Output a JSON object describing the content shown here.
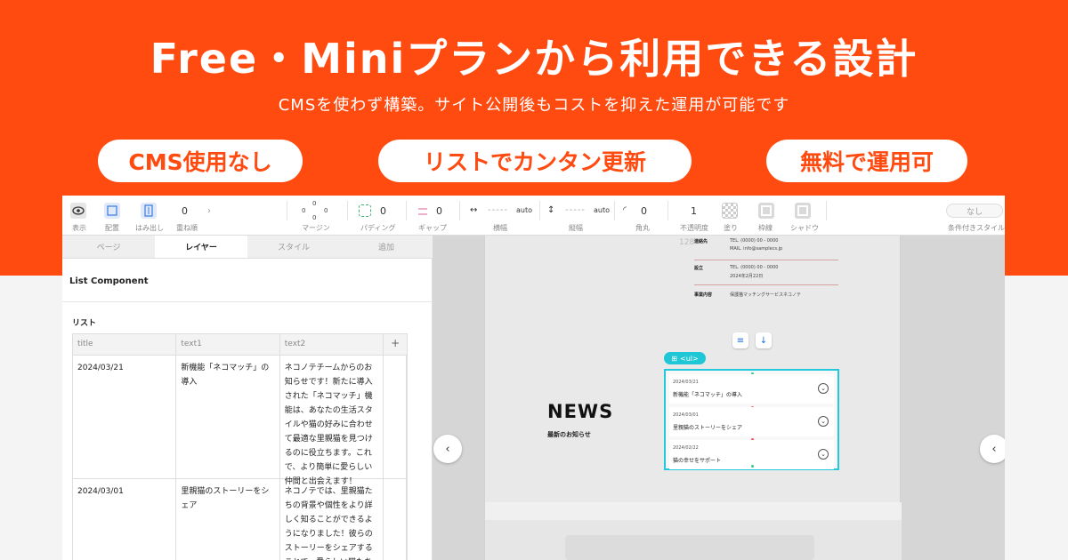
{
  "hero": {
    "title": "Free・Miniプランから利用できる設計",
    "subtitle": "CMSを使わず構築。サイト公開後もコストを抑えた運用が可能です",
    "features": [
      "CMS使用なし",
      "リストでカンタン更新",
      "無料で運用可"
    ],
    "accent_color": "#ff4a10"
  },
  "toolbar": {
    "display_label": "表示",
    "placement_label": "配置",
    "overflow_label": "はみ出し",
    "zindex_value": "0",
    "zindex_label": "重ね順",
    "margin_top": "0",
    "margin_left": "0",
    "margin_right": "0",
    "margin_bottom": "0",
    "margin_label": "マージン",
    "padding_value": "0",
    "padding_label": "パディング",
    "gap_value": "0",
    "gap_label": "ギャップ",
    "width_value": "auto",
    "width_label": "横幅",
    "height_value": "auto",
    "height_label": "縦幅",
    "radius_value": "0",
    "radius_label": "角丸",
    "opacity_value": "1",
    "opacity_label": "不透明度",
    "fill_label": "塗り",
    "border_label": "枠線",
    "shadow_label": "シャドウ",
    "conditional_value": "なし",
    "conditional_label": "条件付きスタイル"
  },
  "panel": {
    "tabs": [
      {
        "label": "ページ",
        "active": false
      },
      {
        "label": "レイヤー",
        "active": true
      },
      {
        "label": "スタイル",
        "active": false
      },
      {
        "label": "追加",
        "active": false
      }
    ],
    "component_title": "List Component",
    "list_label": "リスト",
    "columns": [
      "title",
      "text1",
      "text2"
    ],
    "add_column": "+",
    "rows": [
      {
        "title": "2024/03/21",
        "text1": "新機能「ネコマッチ」の導入",
        "text2": "ネコノテチームからのお知らせです！新たに導入された「ネコマッチ」機能は、あなたの生活スタイルや猫の好みに合わせて最適な里親猫を見つけるのに役立ちます。これで、より簡単に愛らしい仲間と出会えます！"
      },
      {
        "title": "2024/03/01",
        "text1": "里親猫のストーリーをシェア",
        "text2": "ネコノテでは、里親猫たちの背景や個性をより詳しく知ることができるようになりました！彼らのストーリーをシェアすることで、愛らしい猫たちとの絆を深め"
      }
    ]
  },
  "canvas": {
    "info": {
      "contact_key": "連絡先",
      "contact_tel": "TEL. (0000) 00 - 0000",
      "contact_mail": "MAIL. info@samplecs.jp",
      "founded_key": "設立",
      "founded_tel": "TEL. (0000) 00 - 0000",
      "founded_date": "2024年2月22日",
      "business_key": "事業内容",
      "business_value": "保護猫マッチングサービスネコノテ",
      "fragment": "128"
    },
    "news_title": "NEWS",
    "news_subtitle": "最新のお知らせ",
    "ul_tag": "<ul>",
    "items": [
      {
        "date": "2024/03/21",
        "text": "新機能「ネコマッチ」の導入"
      },
      {
        "date": "2024/03/01",
        "text": "里親猫のストーリーをシェア"
      },
      {
        "date": "2024/02/22",
        "text": "猫の幸せをサポート"
      }
    ],
    "nav_prev": "‹",
    "nav_next": "‹"
  }
}
